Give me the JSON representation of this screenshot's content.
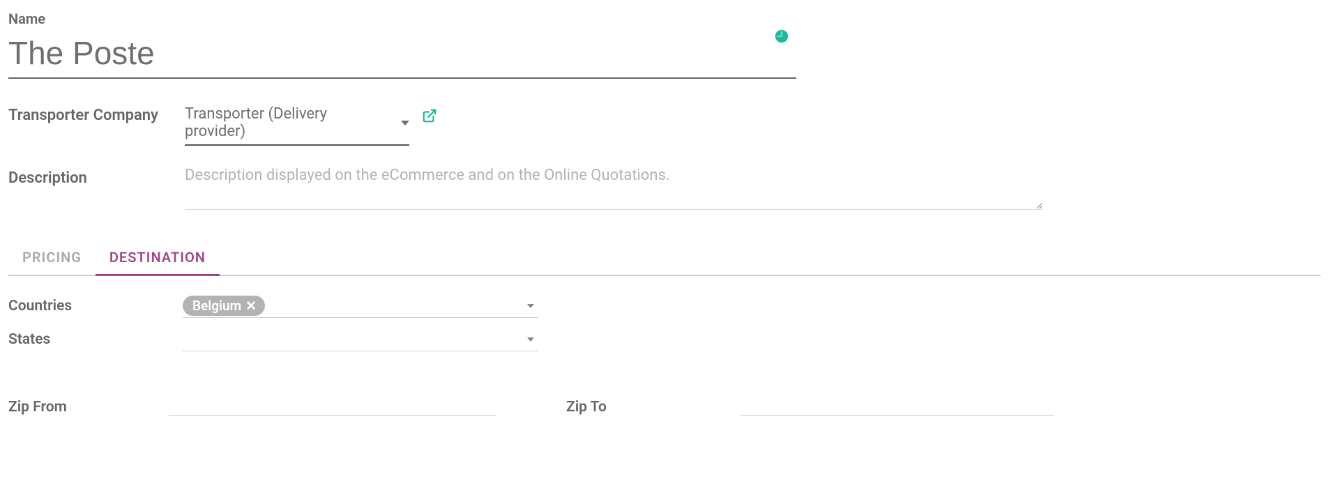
{
  "name": {
    "label": "Name",
    "value": "The Poste"
  },
  "transporter": {
    "label": "Transporter Company",
    "value": "Transporter (Delivery provider)"
  },
  "description": {
    "label": "Description",
    "value": "",
    "placeholder": "Description displayed on the eCommerce and on the Online Quotations."
  },
  "tabs": {
    "pricing": "PRICING",
    "destination": "DESTINATION",
    "active": "destination"
  },
  "destination": {
    "countries": {
      "label": "Countries",
      "tags": [
        "Belgium"
      ]
    },
    "states": {
      "label": "States"
    },
    "zip_from": {
      "label": "Zip From",
      "value": ""
    },
    "zip_to": {
      "label": "Zip To",
      "value": ""
    }
  }
}
